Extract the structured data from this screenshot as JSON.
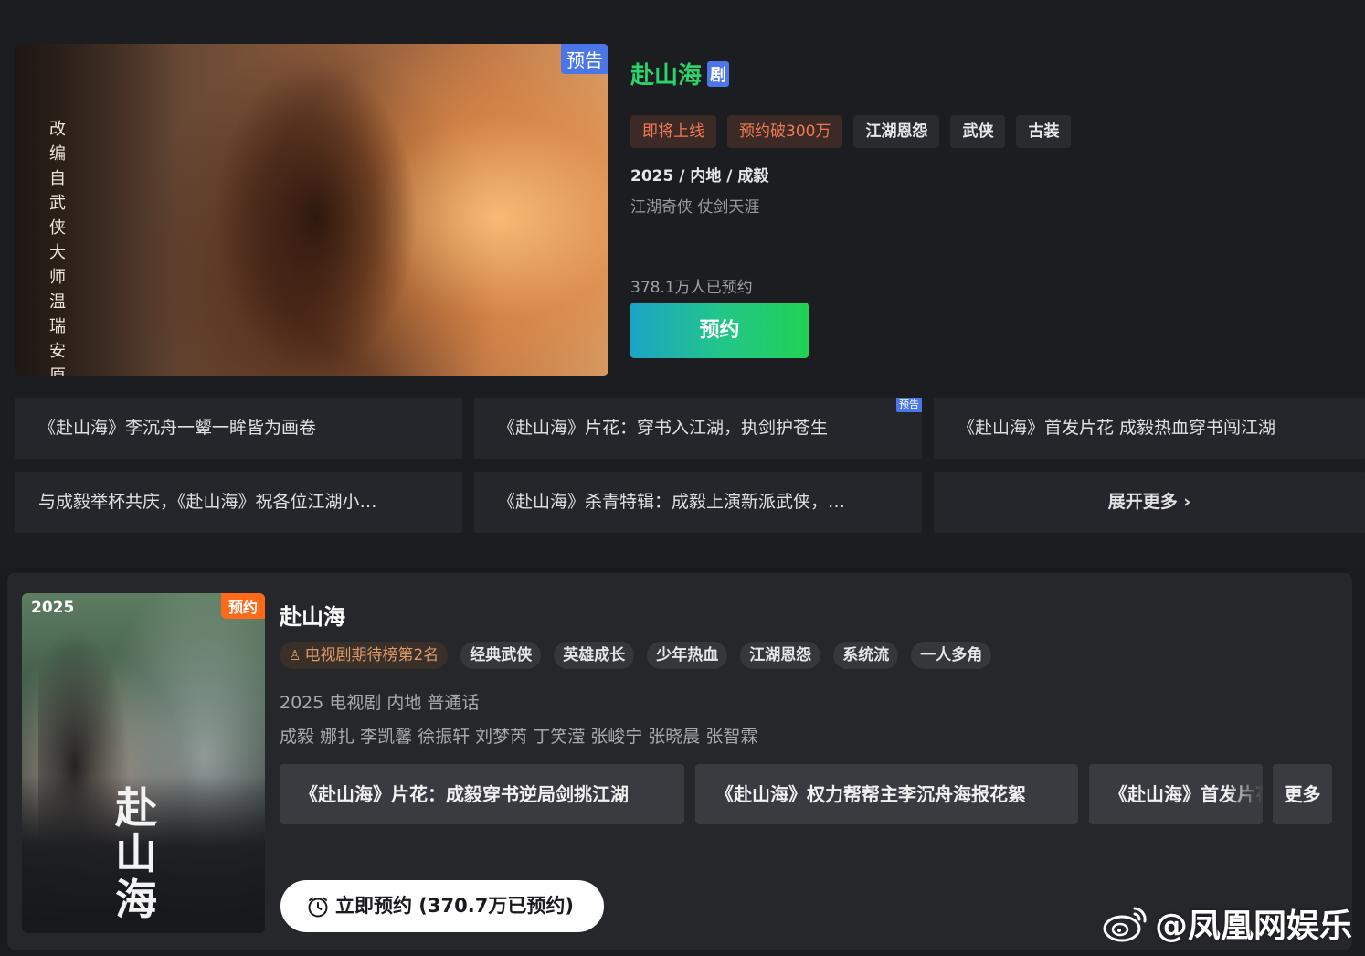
{
  "featured": {
    "poster_vertical_text": "改编自武侠大师温瑞安原著",
    "poster_badge": "预告",
    "title": "赴山海",
    "type_badge": "剧",
    "tags": [
      {
        "label": "即将上线",
        "style": "hot"
      },
      {
        "label": "预约破300万",
        "style": "hot"
      },
      {
        "label": "江湖恩怨",
        "style": "normal"
      },
      {
        "label": "武侠",
        "style": "normal"
      },
      {
        "label": "古装",
        "style": "normal"
      }
    ],
    "meta": "2025 / 内地 / 成毅",
    "slogan": "江湖奇侠 仗剑天涯",
    "reserve_count": "378.1万人已预约",
    "reserve_label": "预约",
    "videos": [
      {
        "title": "《赴山海》李沉舟一颦一眸皆为画卷",
        "badge": ""
      },
      {
        "title": "《赴山海》片花：穿书入江湖，执剑护苍生",
        "badge": "预告"
      },
      {
        "title": "《赴山海》首发片花 成毅热血穿书闯江湖",
        "badge": ""
      },
      {
        "title": "与成毅举杯共庆，《赴山海》祝各位江湖小…",
        "badge": ""
      },
      {
        "title": "《赴山海》杀青特辑：成毅上演新派武侠，…",
        "badge": ""
      }
    ],
    "expand_label": "展开更多 ›"
  },
  "detail": {
    "poster_year": "2025",
    "poster_badge": "预约",
    "poster_calligraphy": "赴山海",
    "title": "赴山海",
    "rank_tag": "电视剧期待榜第2名",
    "tags": [
      "经典武侠",
      "英雄成长",
      "少年热血",
      "江湖恩怨",
      "系统流",
      "一人多角"
    ],
    "meta": "2025 电视剧 内地 普通话",
    "cast": "成毅 娜扎 李凯馨 徐振轩 刘梦芮 丁笑滢 张峻宁 张晓晨 张智霖",
    "clips": [
      "《赴山海》片花：成毅穿书逆局剑挑江湖",
      "《赴山海》权力帮帮主李沉舟海报花絮",
      "《赴山海》首发片花"
    ],
    "more_label": "更多",
    "reserve_button": "立即预约 (370.7万已预约)"
  },
  "watermark": "@凤凰网娱乐",
  "colors": {
    "accent_green": "#2bd46a",
    "badge_blue": "#4a76e8",
    "badge_orange": "#ff6a1a",
    "hot_tag_text": "#f07a52"
  }
}
